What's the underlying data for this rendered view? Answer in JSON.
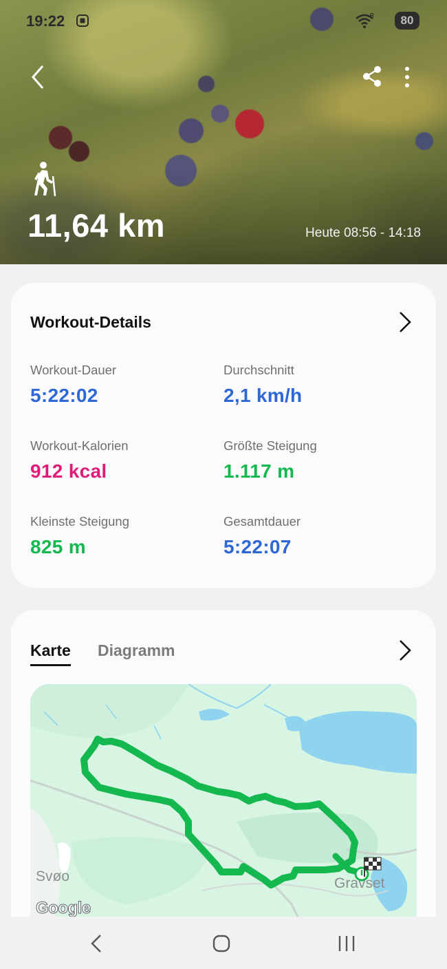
{
  "status_bar": {
    "time": "19:22",
    "battery": "80",
    "icons": [
      "screen-recorder-icon",
      "wifi-icon"
    ]
  },
  "hero": {
    "distance": "11,64 km",
    "time_range": "Heute 08:56 - 14:18",
    "activity_icon": "hiking-icon"
  },
  "details": {
    "title": "Workout-Details",
    "stats": [
      {
        "label": "Workout-Dauer",
        "value": "5:22:02",
        "color": "#2e68d6"
      },
      {
        "label": "Durchschnitt",
        "value": "2,1 km/h",
        "color": "#2e68d6"
      },
      {
        "label": "Workout-Kalorien",
        "value": "912 kcal",
        "color": "#e01c78"
      },
      {
        "label": "Größte Steigung",
        "value": "1.117 m",
        "color": "#14b84f"
      },
      {
        "label": "Kleinste Steigung",
        "value": "825 m",
        "color": "#14b84f"
      },
      {
        "label": "Gesamtdauer",
        "value": "5:22:07",
        "color": "#2e68d6"
      }
    ]
  },
  "map_card": {
    "tabs": [
      {
        "label": "Karte",
        "selected": true
      },
      {
        "label": "Diagramm",
        "selected": false
      }
    ],
    "map_labels": {
      "place_left": "Svøo",
      "place_right": "Gravset",
      "attribution": "Google"
    },
    "route_color": "#14b84f"
  },
  "nav_bar": {
    "buttons": [
      "back-nav-icon",
      "home-nav-icon",
      "recent-apps-icon"
    ]
  }
}
